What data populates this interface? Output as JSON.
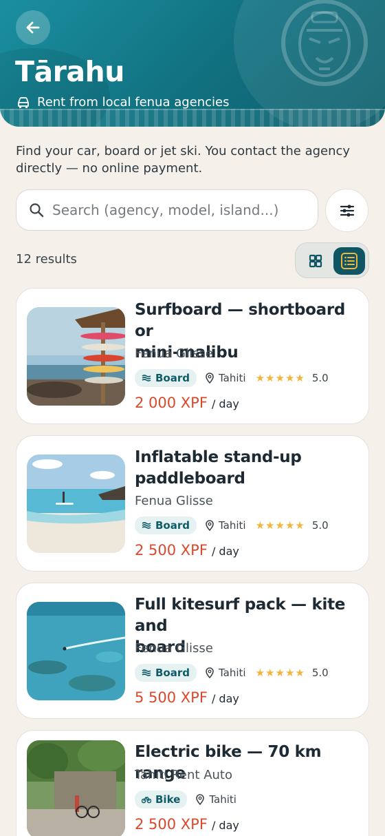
{
  "header": {
    "brand": "Tārahu",
    "subtitle": "Rent from local fenua agencies",
    "back_icon": "arrow-left-icon",
    "subtitle_icon": "car-icon",
    "accent": "#11707f"
  },
  "intro": {
    "text": "Find your car, board or jet ski. You contact the agency directly — no online payment."
  },
  "search": {
    "placeholder": "Search (agency, model, island...)",
    "icon": "search-icon",
    "filter_icon": "sliders-icon"
  },
  "results": {
    "count": "12 results",
    "views": [
      "grid-icon",
      "list-icon"
    ],
    "active_view": "list"
  },
  "listings": [
    {
      "title_line1": "Surfboard — shortboard or",
      "title_line2": "mini-malibu",
      "agency": "Fenua Glisse",
      "category": "Board",
      "location": "Tahiti",
      "stars": "★★★★★",
      "rating": "5.0",
      "price": "2 000 XPF",
      "unit": "/ day"
    },
    {
      "title_line1": "Inflatable stand-up",
      "title_line2": "paddleboard",
      "agency": "Fenua Glisse",
      "category": "Board",
      "location": "Tahiti",
      "stars": "★★★★★",
      "rating": "5.0",
      "price": "2 500 XPF",
      "unit": "/ day"
    },
    {
      "title_line1": "Full kitesurf pack — kite and",
      "title_line2": "board",
      "agency": "Fenua Glisse",
      "category": "Board",
      "location": "Tahiti",
      "stars": "★★★★★",
      "rating": "5.0",
      "price": "5 500 XPF",
      "unit": "/ day"
    },
    {
      "title_line1": "Electric bike — 70 km range",
      "agency": "Tahiti Rent Auto",
      "category": "Bike",
      "location": "Tahiti",
      "price": "2 500 XPF",
      "unit": "/ day"
    }
  ],
  "colors": {
    "price": "#d9492b",
    "badge_bg": "#e6f1f1",
    "badge_text": "#0f5c68",
    "star": "#f2b43a"
  }
}
